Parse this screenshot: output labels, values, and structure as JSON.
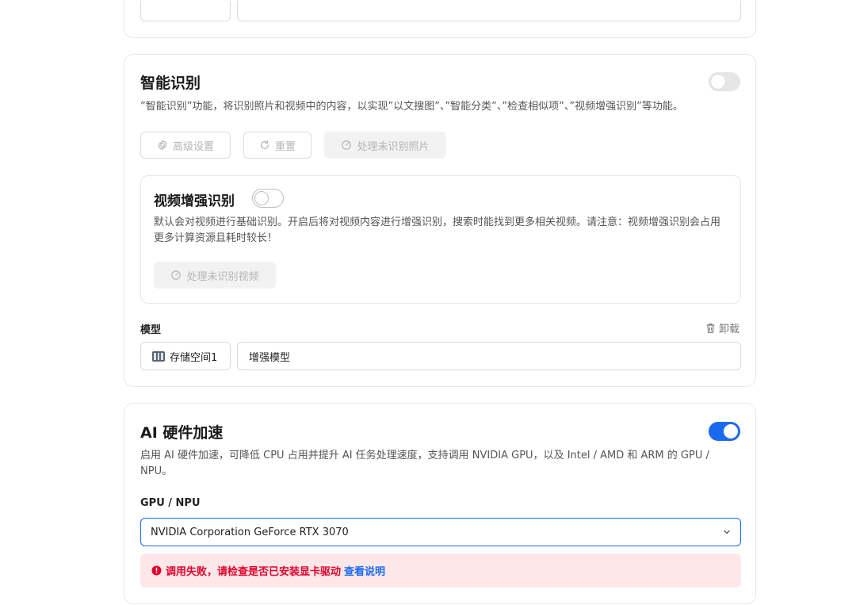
{
  "smart_recognition": {
    "title": "智能识别",
    "enabled": false,
    "description": "”智能识别”功能，将识别照片和视频中的内容，以实现”以文搜图”、”智能分类”、”检查相似项”、”视频增强识别”等功能。",
    "buttons": {
      "advanced_settings": "高级设置",
      "reset": "重置",
      "process_photos": "处理未识别照片"
    },
    "video_enhance": {
      "title": "视频增强识别",
      "enabled": false,
      "description": "默认会对视频进行基础识别。开启后将对视频内容进行增强识别，搜索时能找到更多相关视频。请注意：视频增强识别会占用更多计算资源且耗时较长！",
      "process_videos": "处理未识别视频"
    },
    "model": {
      "label": "模型",
      "uninstall": "卸载",
      "storage": "存储空间1",
      "value": "增强模型"
    }
  },
  "hw_accel": {
    "title": "AI 硬件加速",
    "enabled": true,
    "description": "启用 AI 硬件加速，可降低 CPU 占用并提升 AI 任务处理速度，支持调用 NVIDIA GPU，以及 Intel / AMD 和 ARM 的 GPU / NPU。",
    "gpu_label": "GPU / NPU",
    "gpu_selected": "NVIDIA Corporation GeForce RTX 3070",
    "error_text": "调用失败，请检查是否已安装显卡驱动",
    "error_link": "查看说明"
  },
  "colors": {
    "accent": "#1a6af0",
    "error": "#e2002b",
    "error_bg": "#fde7e9"
  }
}
